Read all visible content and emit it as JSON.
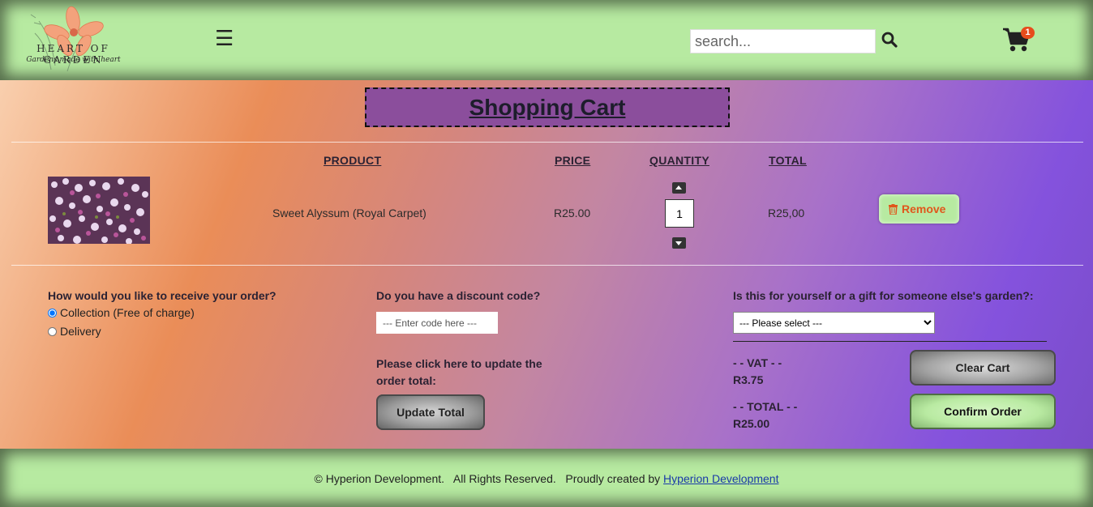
{
  "header": {
    "logo_text": "HEART OF GARDEN",
    "logo_tagline": "Gardens made with heart",
    "search_placeholder": "search...",
    "cart_count": "1"
  },
  "cart": {
    "title": "Shopping Cart",
    "columns": {
      "product": "PRODUCT",
      "price": "PRICE",
      "quantity": "QUANTITY",
      "total": "TOTAL"
    },
    "items": [
      {
        "name": "Sweet Alyssum (Royal Carpet)",
        "price": "R25.00",
        "quantity": "1",
        "total": "R25,00",
        "remove_label": "Remove"
      }
    ]
  },
  "delivery": {
    "question": "How would you like to receive your order?",
    "options": [
      "Collection (Free of charge)",
      "Delivery"
    ],
    "selected": "Collection (Free of charge)"
  },
  "discount": {
    "question": "Do you have a discount code?",
    "placeholder": "--- Enter code here ---",
    "update_prompt": "Please click here to update the order total:",
    "update_label": "Update Total"
  },
  "gift": {
    "question": "Is this for yourself or a gift for someone else's garden?:",
    "selected": "--- Please select ---"
  },
  "summary": {
    "vat_label": "- - VAT - -",
    "vat_value": "R3.75",
    "total_label": "- - TOTAL - -",
    "total_value": "R25.00",
    "clear_label": "Clear Cart",
    "confirm_label": "Confirm Order"
  },
  "footer": {
    "text": "© Hyperion Development.   All Rights Reserved.   Proudly created by ",
    "link_text": "Hyperion Development"
  },
  "colors": {
    "header_green": "#b7eaa1",
    "title_purple": "#8b4e9c",
    "remove_orange": "#e0571c",
    "badge_red": "#e74c1c"
  }
}
